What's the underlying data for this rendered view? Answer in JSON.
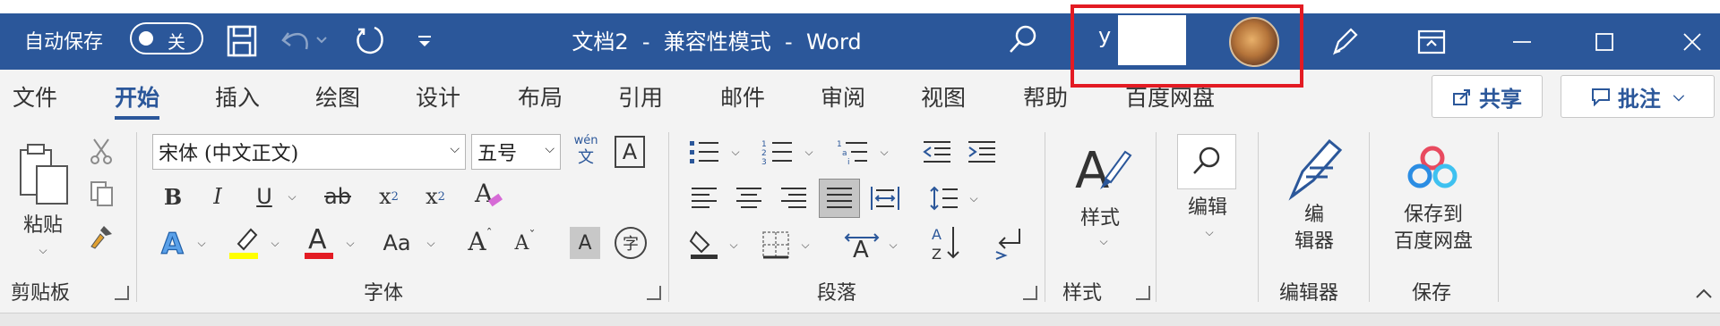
{
  "titlebar": {
    "autosave_label": "自动保存",
    "autosave_state": "关",
    "doc_title": "文档2  -  兼容性模式  -  Word",
    "username": "y          dy",
    "colors": {
      "bar": "#2b579a",
      "highlight": "#e31b23"
    }
  },
  "tabs": [
    {
      "label": "文件"
    },
    {
      "label": "开始",
      "active": true
    },
    {
      "label": "插入"
    },
    {
      "label": "绘图"
    },
    {
      "label": "设计"
    },
    {
      "label": "布局"
    },
    {
      "label": "引用"
    },
    {
      "label": "邮件"
    },
    {
      "label": "审阅"
    },
    {
      "label": "视图"
    },
    {
      "label": "帮助"
    },
    {
      "label": "百度网盘"
    }
  ],
  "actions": {
    "share": "共享",
    "comments": "批注"
  },
  "clipboard": {
    "paste": "粘贴",
    "group": "剪贴板"
  },
  "font": {
    "name": "宋体 (中文正文)",
    "size": "五号",
    "wen_top": "wén",
    "wen_bottom": "文",
    "border_char": "A",
    "bold": "B",
    "italic": "I",
    "underline": "U",
    "strike": "ab",
    "sub": "x",
    "sub_mark": "2",
    "sup": "x",
    "sup_mark": "2",
    "change_case": "Aa",
    "grow": "A",
    "shrink": "A",
    "shade_char": "A",
    "enclose": "字",
    "group": "字体"
  },
  "paragraph": {
    "group": "段落"
  },
  "styles": {
    "label": "样式",
    "group": "样式"
  },
  "editing": {
    "label": "编辑"
  },
  "editor": {
    "label_line1": "编",
    "label_line2": "辑器",
    "group": "编辑器"
  },
  "baidu": {
    "label_line1": "保存到",
    "label_line2": "百度网盘",
    "group": "保存"
  }
}
